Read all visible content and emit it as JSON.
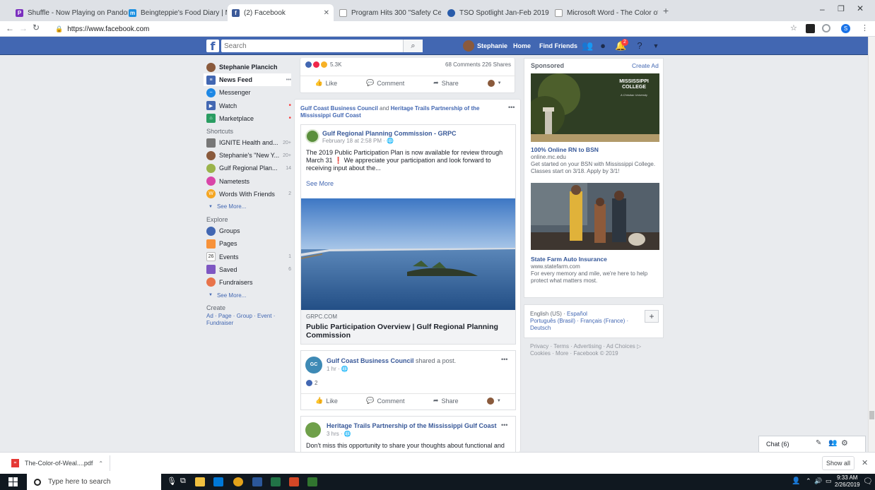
{
  "browser": {
    "tabs": [
      {
        "title": "Shuffle - Now Playing on Pandor",
        "active": false
      },
      {
        "title": "Beingteppie's Food Diary | MyFit",
        "active": false
      },
      {
        "title": "(2) Facebook",
        "active": true
      },
      {
        "title": "Program Hits 300 \"Safety Certifie",
        "active": false
      },
      {
        "title": "TSO Spotlight Jan-Feb 2019",
        "active": false
      },
      {
        "title": "Microsoft Word - The Color of W",
        "active": false
      }
    ],
    "url": "https://www.facebook.com"
  },
  "fb_header": {
    "search_placeholder": "Search",
    "user_name": "Stephanie",
    "home": "Home",
    "find_friends": "Find Friends",
    "notification_count": "2"
  },
  "left_nav": {
    "profile_name": "Stephanie Plancich",
    "main_items": [
      {
        "label": "News Feed",
        "count": "•••"
      },
      {
        "label": "Messenger",
        "count": ""
      },
      {
        "label": "Watch",
        "count": "•"
      },
      {
        "label": "Marketplace",
        "count": "•"
      }
    ],
    "shortcuts_title": "Shortcuts",
    "shortcuts": [
      {
        "label": "IGNITE Health and...",
        "count": "20+"
      },
      {
        "label": "Stephanie's \"New Y...",
        "count": "20+"
      },
      {
        "label": "Gulf Regional Plan...",
        "count": "14"
      },
      {
        "label": "Nametests",
        "count": ""
      },
      {
        "label": "Words With Friends",
        "count": "2"
      }
    ],
    "see_more_1": "See More...",
    "explore_title": "Explore",
    "explore": [
      {
        "label": "Groups",
        "count": ""
      },
      {
        "label": "Pages",
        "count": ""
      },
      {
        "label": "Events",
        "count": "1"
      },
      {
        "label": "Saved",
        "count": "6"
      },
      {
        "label": "Fundraisers",
        "count": ""
      }
    ],
    "see_more_2": "See More...",
    "create_title": "Create",
    "create_links": "Ad · Page · Group · Event · Fundraiser"
  },
  "feed": {
    "top_stats": {
      "reactions": "5.3K",
      "comments": "68 Comments",
      "shares": "226 Shares"
    },
    "actions": {
      "like": "Like",
      "comment": "Comment",
      "share": "Share"
    },
    "shared_header": {
      "org1": "Gulf Coast Business Council",
      "connector": "and",
      "org2": "Heritage Trails Partnership of the Mississippi Gulf Coast"
    },
    "grpc_post": {
      "name": "Gulf Regional Planning Commission - GRPC",
      "time": "February 18 at 2:58 PM · ",
      "text": "The 2019 Public Participation Plan is now available for review through March 31 ❗ We appreciate your participation and look forward to receiving input about the...",
      "see_more": "See More",
      "link_domain": "GRPC.COM",
      "link_title": "Public Participation Overview | Gulf Regional Planning Commission"
    },
    "gcbc_post": {
      "name": "Gulf Coast Business Council",
      "suffix": "shared a post.",
      "time": "1 hr · ",
      "reactions": "2"
    },
    "heritage_post": {
      "name": "Heritage Trails Partnership of the Mississippi Gulf Coast",
      "time": "3 hrs · ",
      "text": "Don't miss this opportunity to share your thoughts about functional and"
    }
  },
  "right_col": {
    "sponsored": "Sponsored",
    "create_ad": "Create Ad",
    "ad1": {
      "image_text": "MISSISSIPPI COLLEGE",
      "image_sub": "A Christian University",
      "title": "100% Online RN to BSN",
      "url": "online.mc.edu",
      "text": "Get started on your BSN with Mississippi College. Classes start on 3/18. Apply by 3/1!"
    },
    "ad2": {
      "title": "State Farm Auto Insurance",
      "url": "www.statefarm.com",
      "text": "For every memory and mile, we're here to help protect what matters most."
    },
    "languages": {
      "current": "English (US) · ",
      "l1": "Español",
      "l2": "Português (Brasil) · Français (France) ·",
      "l3": "Deutsch"
    },
    "footer": "Privacy · Terms · Advertising · Ad Choices ▷ Cookies · More · Facebook © 2019"
  },
  "chat": {
    "label": "Chat (6)"
  },
  "download_bar": {
    "file": "The-Color-of-Weal....pdf",
    "show_all": "Show all"
  },
  "taskbar": {
    "search_placeholder": "Type here to search",
    "time": "9:33 AM",
    "date": "2/26/2019"
  }
}
